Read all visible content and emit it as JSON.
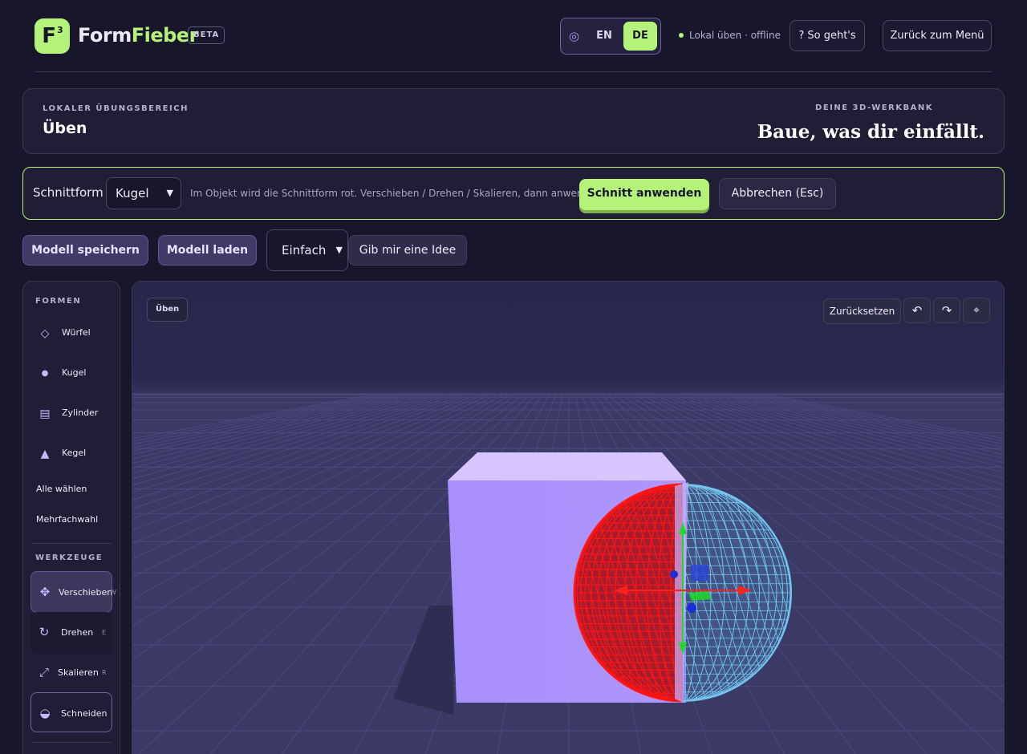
{
  "header": {
    "logo_glyph": "F",
    "logo_sup": "3",
    "brand_part1": "Form",
    "brand_part2": "Fieber",
    "beta": "BETA",
    "lang_icon": "target-icon",
    "lang_en": "EN",
    "lang_de": "DE",
    "status": "Lokal üben · offline",
    "help_button": "? So geht's",
    "back_button": "Zurück zum Menü"
  },
  "card": {
    "kicker_left": "LOKALER ÜBUNGSBEREICH",
    "title_left": "Üben",
    "kicker_right": "DEINE 3D-WERKBANK",
    "title_right": "Baue, was dir einfällt."
  },
  "cut": {
    "label": "Schnittform",
    "shape_value": "Kugel",
    "hint": "Im Objekt wird die Schnittform rot. Verschieben / Drehen / Skalieren, dann anwenden.",
    "apply": "Schnitt anwenden",
    "cancel": "Abbrechen (Esc)"
  },
  "toolbar": {
    "save": "Modell speichern",
    "load": "Modell laden",
    "difficulty": "Einfach",
    "idea": "Gib mir eine Idee"
  },
  "sidebar": {
    "shapes_heading": "FORMEN",
    "shapes": [
      {
        "label": "Würfel",
        "icon": "diamond-icon",
        "glyph": "◇"
      },
      {
        "label": "Kugel",
        "icon": "sphere-icon",
        "glyph": "●"
      },
      {
        "label": "Zylinder",
        "icon": "cylinder-icon",
        "glyph": "▤"
      },
      {
        "label": "Kegel",
        "icon": "cone-icon",
        "glyph": "▲"
      }
    ],
    "select_all": "Alle wählen",
    "multi_select": "Mehrfachwahl",
    "tools_heading": "WERKZEUGE",
    "tools": [
      {
        "label": "Verschieben",
        "key": "W",
        "icon": "move-icon",
        "glyph": "✥"
      },
      {
        "label": "Drehen",
        "key": "E",
        "icon": "rotate-icon",
        "glyph": "↻"
      },
      {
        "label": "Skalieren",
        "key": "R",
        "icon": "scale-icon",
        "glyph": "⤢"
      },
      {
        "label": "Schneiden",
        "key": "",
        "icon": "cut-icon",
        "glyph": "◒"
      }
    ]
  },
  "viewport": {
    "mode_badge": "Üben",
    "reset": "Zurücksetzen",
    "undo_icon": "undo-icon",
    "redo_icon": "redo-icon",
    "center_icon": "crosshair-icon",
    "undo_glyph": "↶",
    "redo_glyph": "↷",
    "center_glyph": "⌖"
  },
  "colors": {
    "accent": "#b5f27a",
    "background": "#17162b",
    "cube": "#ab92fc",
    "cut_shape": "#ff1a1a",
    "sphere_wire": "#5fc2ee"
  }
}
